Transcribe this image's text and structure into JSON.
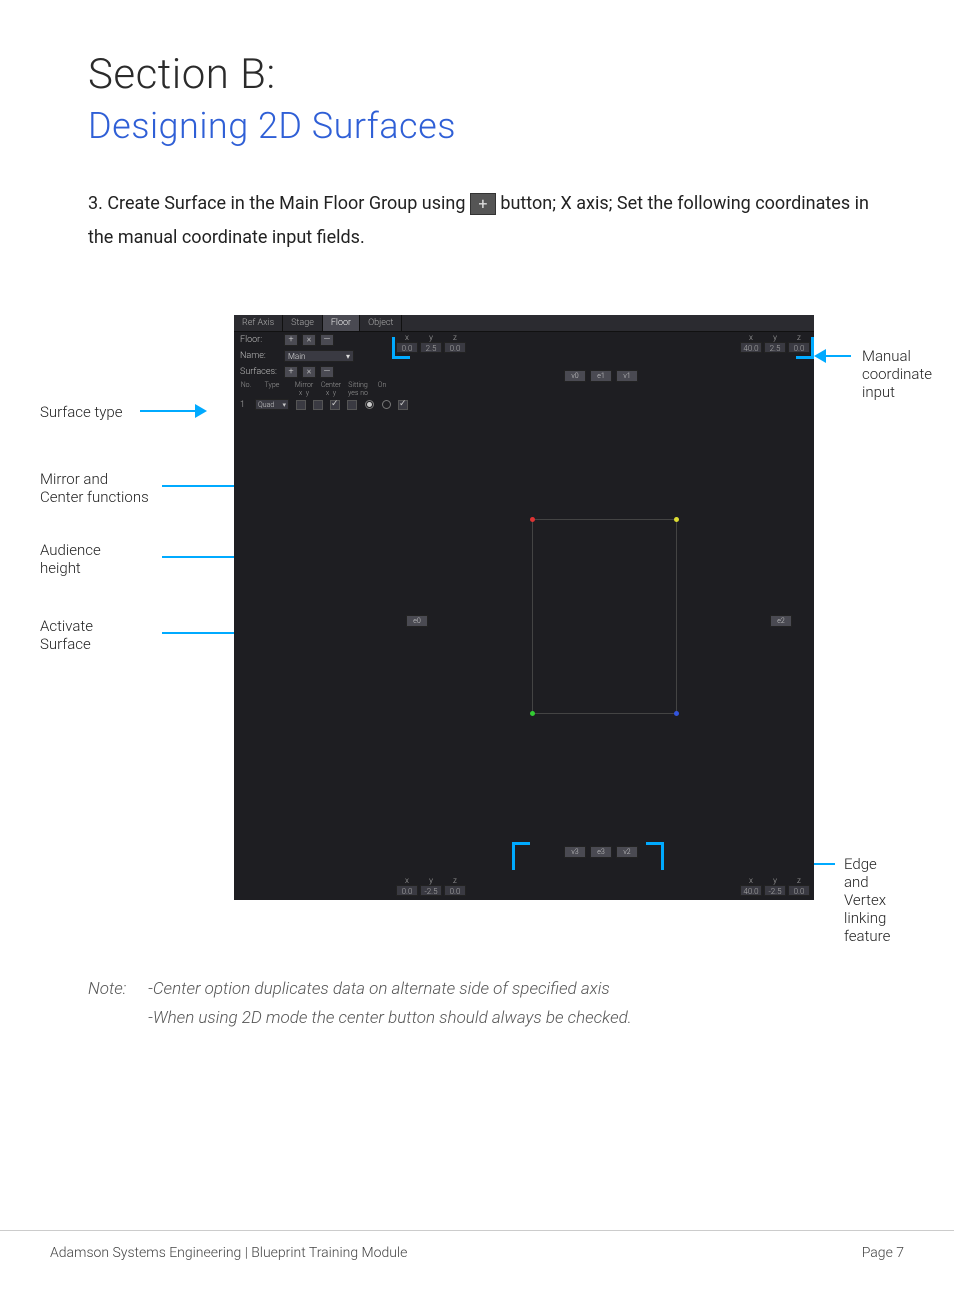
{
  "title_section": "Section B:",
  "title_sub": "Designing 2D Surfaces",
  "step_num": "3.",
  "step_a": "Create Surface in the Main Floor Group using",
  "step_b": "button; X axis; Set the following coordinates in the manual coordinate input fields.",
  "plus_glyph": "+",
  "annotations": {
    "surface_type": "Surface type",
    "mirror_center": "Mirror and\nCenter functions",
    "audience_height": "Audience\nheight",
    "activate_surface": "Activate\nSurface",
    "manual_coord": "Manual\ncoordinate\ninput",
    "edge_vertex": "Edge and\nVertex linking\nfeature"
  },
  "app": {
    "tabs": [
      "Ref Axis",
      "Stage",
      "Floor",
      "Object"
    ],
    "active_tab": 2,
    "rows": {
      "floor_label": "Floor:",
      "name_label": "Name:",
      "surfaces_label": "Surfaces:",
      "name_value": "Main"
    },
    "surface_headers": {
      "no": "No.",
      "type": "Type",
      "mirror": "Mirror",
      "center": "Center",
      "sitting": "Sitting",
      "on": "On"
    },
    "sub_xy": {
      "x": "x",
      "y": "y",
      "yes": "yes",
      "no": "no"
    },
    "surface_row": {
      "idx": "1",
      "type": "Quad",
      "mirror_x": false,
      "mirror_y": false,
      "center_x": true,
      "center_y": false,
      "sitting_yes": true,
      "sitting_no": false,
      "on_yes": false,
      "on_no": true
    },
    "coords_tl": {
      "x": "x",
      "y": "y",
      "z": "z",
      "vx": "0.0",
      "vy": "2.5",
      "vz": "0.0"
    },
    "coords_tr": {
      "x": "x",
      "y": "y",
      "z": "z",
      "vx": "40.0",
      "vy": "2.5",
      "vz": "0.0"
    },
    "coords_bl": {
      "x": "x",
      "y": "y",
      "z": "z",
      "vx": "0.0",
      "vy": "-2.5",
      "vz": "0.0"
    },
    "coords_br": {
      "x": "x",
      "y": "y",
      "z": "z",
      "vx": "40.0",
      "vy": "-2.5",
      "vz": "0.0"
    },
    "vbtns_top": [
      "v0",
      "e1",
      "v1"
    ],
    "vbtns_bot": [
      "v3",
      "e3",
      "v2"
    ],
    "e_left": "e0",
    "e_right": "e2"
  },
  "note": {
    "label": "Note:",
    "l1": "-Center option duplicates data on alternate side of specified axis",
    "l2": "-When using 2D mode the center button should always be checked."
  },
  "footer": {
    "left": "Adamson Systems Engineering  |  Blueprint Training Module",
    "right": "Page 7"
  }
}
